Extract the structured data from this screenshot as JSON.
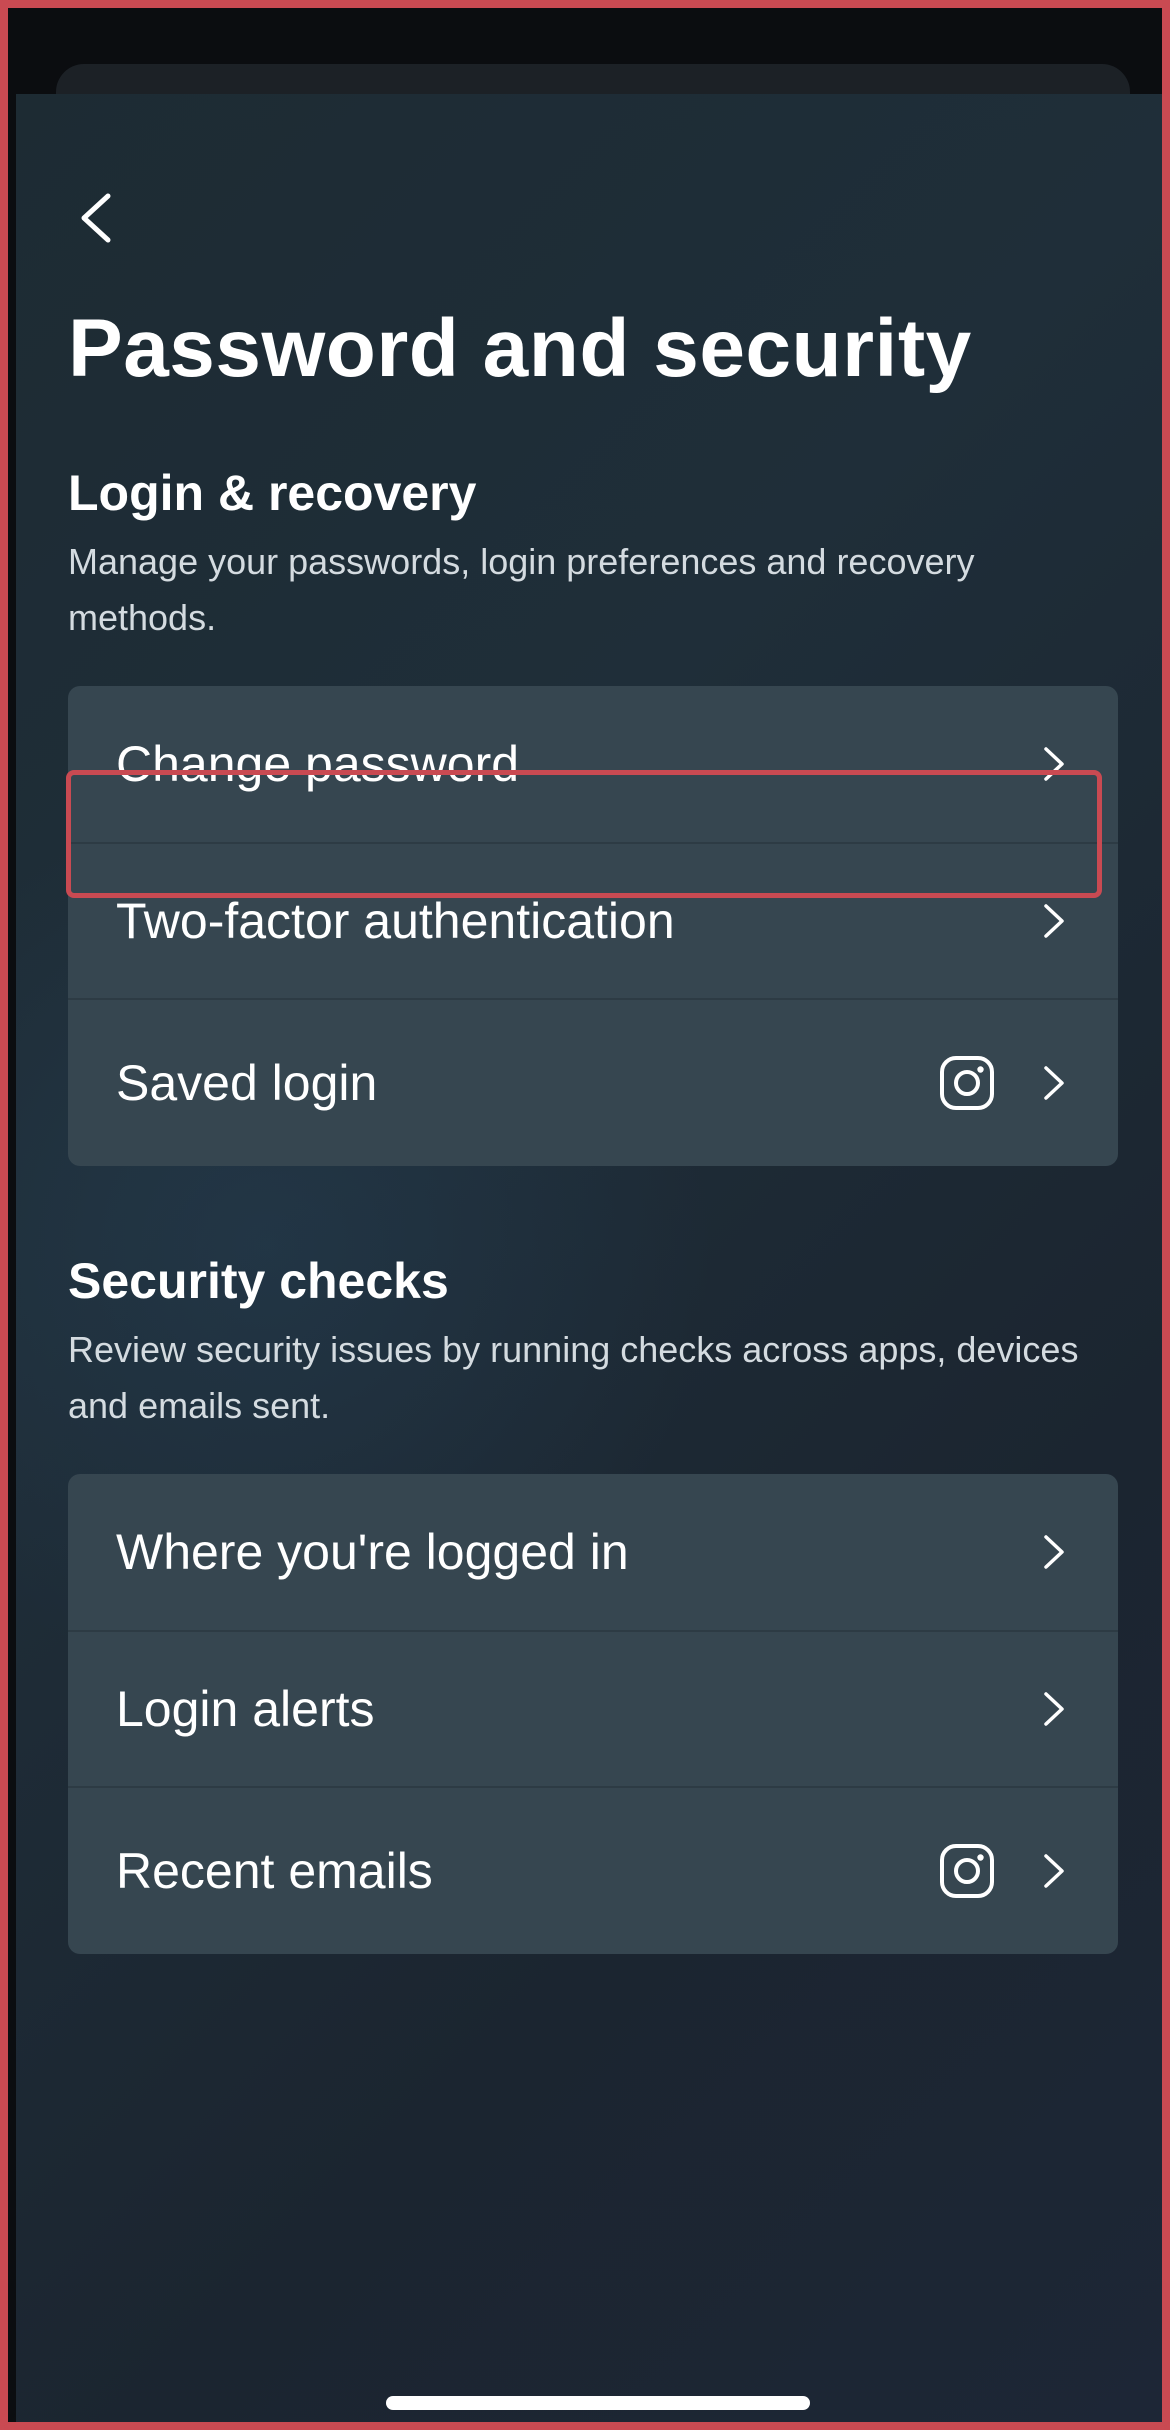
{
  "header": {
    "back_icon": "chevron-left-icon",
    "title": "Password and security"
  },
  "login_recovery": {
    "title": "Login & recovery",
    "description": "Manage your passwords, login preferences and recovery methods.",
    "items": [
      {
        "label": "Change password",
        "icon": null
      },
      {
        "label": "Two-factor authentication",
        "icon": null,
        "highlighted": true
      },
      {
        "label": "Saved login",
        "icon": "instagram-icon"
      }
    ]
  },
  "security_checks": {
    "title": "Security checks",
    "description": "Review security issues by running checks across apps, devices and emails sent.",
    "items": [
      {
        "label": "Where you're logged in",
        "icon": null
      },
      {
        "label": "Login alerts",
        "icon": null
      },
      {
        "label": "Recent emails",
        "icon": "instagram-icon"
      }
    ]
  },
  "colors": {
    "card_bg": "#364650",
    "highlight": "#c94a52",
    "text": "#ffffff",
    "subtext": "#d4dbe0"
  }
}
